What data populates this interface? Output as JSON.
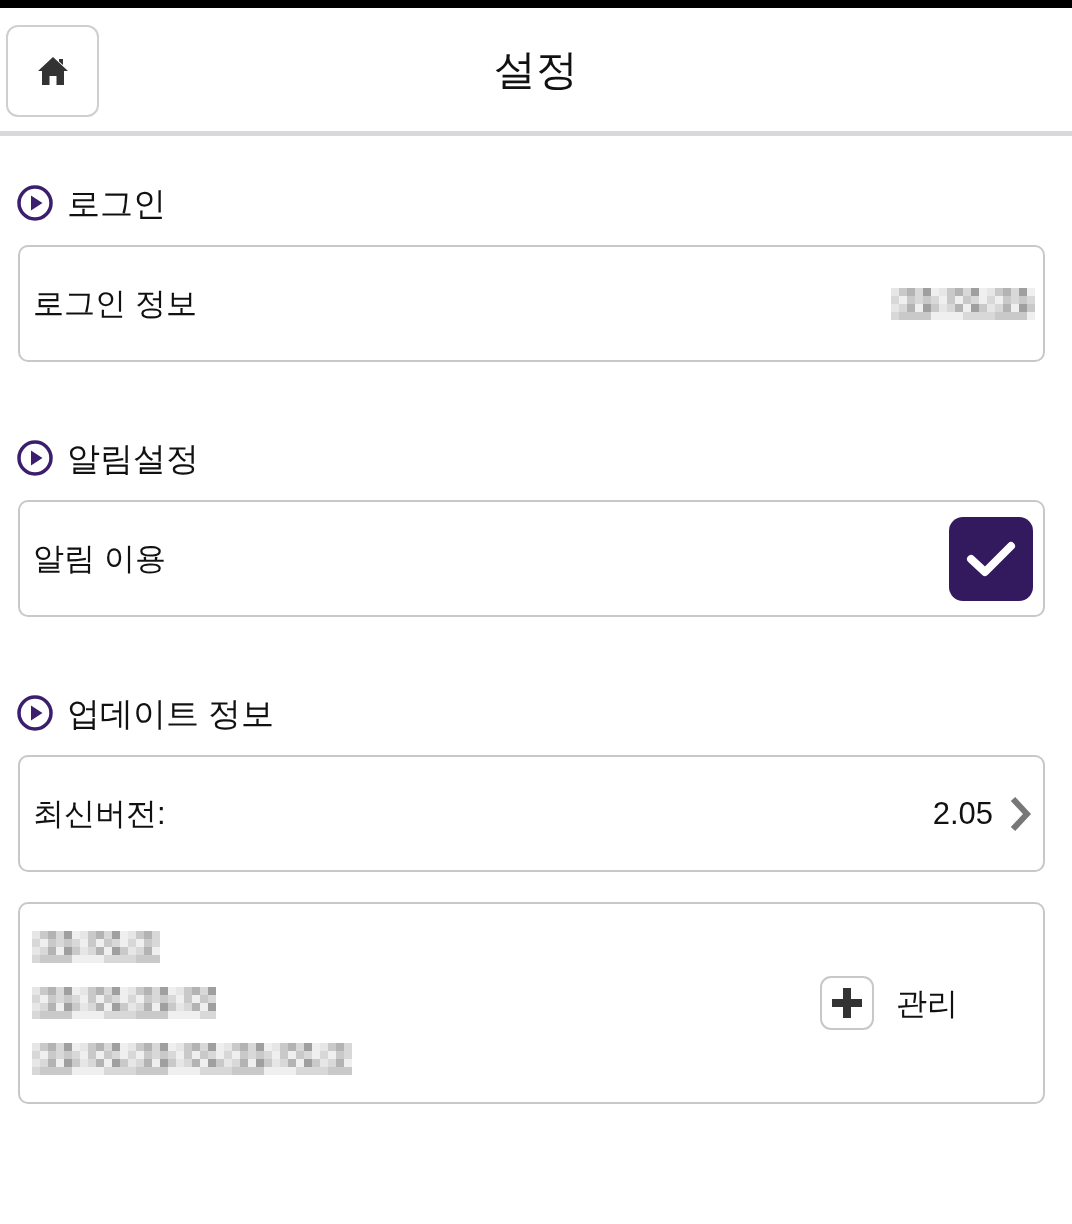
{
  "header": {
    "title": "설정"
  },
  "sections": [
    {
      "title": "로그인",
      "rows": [
        {
          "kind": "info",
          "label": "로그인 정보",
          "value_redacted": true
        }
      ]
    },
    {
      "title": "알림설정",
      "rows": [
        {
          "kind": "toggle",
          "label": "알림 이용",
          "checked": true
        }
      ]
    },
    {
      "title": "업데이트 정보",
      "rows": [
        {
          "kind": "link",
          "label": "최신버전:",
          "value": "2.05"
        },
        {
          "kind": "manage",
          "details_redacted": true,
          "button": "관리"
        }
      ]
    }
  ]
}
